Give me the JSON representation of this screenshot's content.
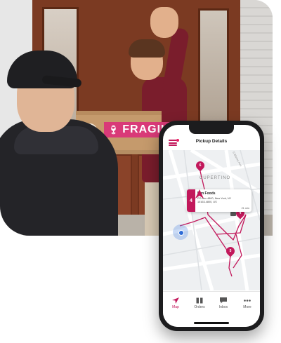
{
  "scene": {
    "box_label": "FRAGILE"
  },
  "app": {
    "title": "Pickup Details",
    "map": {
      "city_label": "CUPERTINO",
      "street_label": "S Blaney Ave",
      "pins": [
        "6",
        "4",
        "5"
      ]
    },
    "card": {
      "stop_number": "4",
      "name": "Fun Foods",
      "address_line1": "PO Box 4800, New York, NY",
      "address_line2": "10163-4800, US",
      "eta": "21 min"
    },
    "tabs": [
      {
        "label": "Map",
        "icon": "navigation-arrow-icon",
        "active": true
      },
      {
        "label": "Orders",
        "icon": "box-icon",
        "active": false
      },
      {
        "label": "Inbox",
        "icon": "chat-icon",
        "active": false
      },
      {
        "label": "More",
        "icon": "more-dots-icon",
        "active": false
      }
    ],
    "colors": {
      "accent": "#c2185b",
      "route": "#c2185b",
      "location": "#2e6bd6"
    }
  }
}
